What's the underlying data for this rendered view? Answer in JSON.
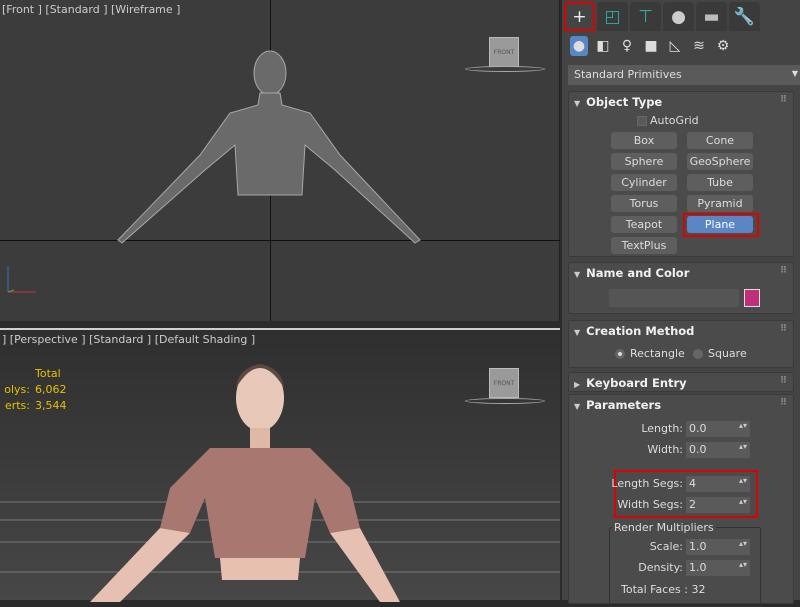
{
  "viewport_top": {
    "label": "[Front ] [Standard ] [Wireframe ]",
    "cube_label": "FRONT"
  },
  "viewport_bottom": {
    "label": "] [Perspective ] [Standard ] [Default Shading ]",
    "cube_label": "FRONT",
    "stats": {
      "header": "Total",
      "rows": [
        {
          "key": "olys:",
          "value": "6,062"
        },
        {
          "key": "erts:",
          "value": "3,544"
        }
      ]
    }
  },
  "panel": {
    "tabs": [
      {
        "icon": "create-plus-icon",
        "active": true
      },
      {
        "icon": "modify-icon"
      },
      {
        "icon": "hierarchy-icon"
      },
      {
        "icon": "motion-icon"
      },
      {
        "icon": "display-icon"
      },
      {
        "icon": "utilities-wrench-icon"
      }
    ],
    "categories": [
      "geometry-icon",
      "shapes-icon",
      "lights-icon",
      "cameras-icon",
      "helpers-icon",
      "space-warps-icon",
      "systems-icon"
    ],
    "dropdown": "Standard Primitives",
    "object_type": {
      "title": "Object Type",
      "autogrid": "AutoGrid",
      "buttons": [
        "Box",
        "Cone",
        "Sphere",
        "GeoSphere",
        "Cylinder",
        "Tube",
        "Torus",
        "Pyramid",
        "Teapot",
        "Plane",
        "TextPlus"
      ],
      "selected": "Plane"
    },
    "name_color": {
      "title": "Name and Color",
      "name": "",
      "color": "#c0307a"
    },
    "creation_method": {
      "title": "Creation Method",
      "options": [
        "Rectangle",
        "Square"
      ],
      "selected": "Rectangle"
    },
    "keyboard_entry": {
      "title": "Keyboard Entry"
    },
    "parameters": {
      "title": "Parameters",
      "length_label": "Length:",
      "length": "0.0",
      "width_label": "Width:",
      "width": "0.0",
      "length_segs_label": "Length Segs:",
      "length_segs": "4",
      "width_segs_label": "Width Segs:",
      "width_segs": "2",
      "render_multipliers": "Render Multipliers",
      "scale_label": "Scale:",
      "scale": "1.0",
      "density_label": "Density:",
      "density": "1.0",
      "total_faces": "Total Faces : 32"
    }
  },
  "accent": "#5b86c5",
  "highlight": "#e00000"
}
